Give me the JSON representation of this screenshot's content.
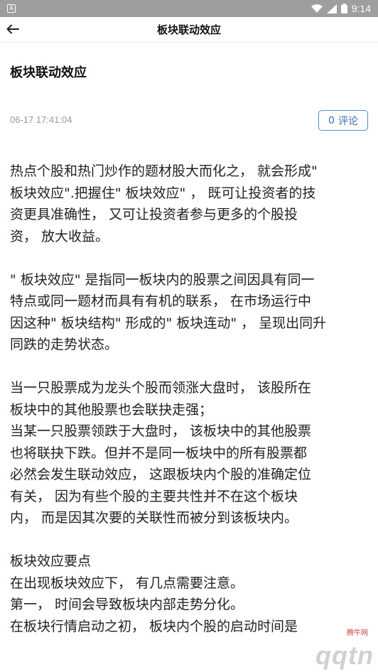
{
  "status_bar": {
    "time": "9:14",
    "notification_icon": "A"
  },
  "app_bar": {
    "title": "板块联动效应",
    "back_icon": "arrow-left-icon"
  },
  "article": {
    "title": "板块联动效应",
    "timestamp": "06-17 17:41:04",
    "comment_count": "0",
    "comment_label": "评论",
    "paragraphs": [
      [
        "热点个股和热门炒作的题材股大而化之， 就会形成\"",
        "板块效应\".把握住\" 板块效应\" ， 既可让投资者的技",
        "资更具准确性， 又可让投资者参与更多的个股投",
        "资， 放大收益。"
      ],
      [
        "\" 板块效应\" 是指同一板块内的股票之间因具有同一",
        "特点或同一题材而具有有机的联系， 在市场运行中",
        "因这种\" 板块结构\" 形成的\" 板块连动\" ， 呈现出同升",
        "同跌的走势状态。"
      ],
      [
        "当一只股票成为龙头个股而领涨大盘时， 该股所在",
        "板块中的其他股票也会联抉走强；",
        "当某一只股票领跌于大盘时， 该板块中的其他股票",
        "也将联抉下跌。但并不是同一板块中的所有股票都",
        "必然会发生联动效应， 这跟板块内个股的准确定位",
        "有关， 因为有些个股的主要共性并不在这个板块",
        "内， 而是因其次要的关联性而被分到该板块内。"
      ],
      [
        "板块效应要点",
        "在出现板块效应下， 有几点需要注意。",
        "第一， 时间会导致板块内部走势分化。",
        "在板块行情启动之初， 板块内个股的启动时间是"
      ]
    ]
  },
  "watermark": {
    "top_text": "腾牛网",
    "main_text": "qqtn"
  }
}
